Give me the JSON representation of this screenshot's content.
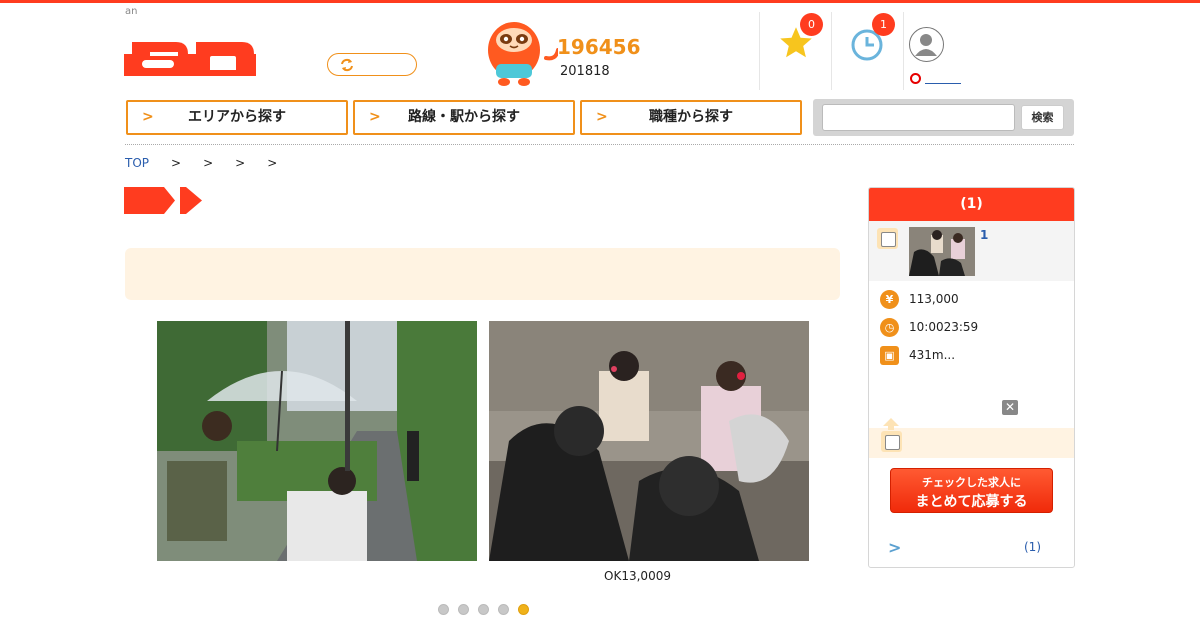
{
  "header": {
    "tagline": "an",
    "counter_main": "196456",
    "counter_sub": "201818",
    "favorites_badge": "0",
    "history_badge": "1"
  },
  "nav": {
    "area": "エリアから探す",
    "route": "路線・駅から探す",
    "job": "職種から探す",
    "search_button": "検索",
    "search_placeholder": ""
  },
  "breadcrumb": {
    "top": "TOP",
    "separators": [
      ">",
      ">",
      ">",
      ">"
    ]
  },
  "gallery": {
    "caption": "OK13,0009",
    "dot_count": 5,
    "active_dot": 5
  },
  "sidebar": {
    "header": "(1)",
    "item_number": "1",
    "salary": "113,000",
    "hours": "10:0023:59",
    "station": "431m...",
    "apply_line1": "チェックした求人に",
    "apply_line2": "まとめて応募する",
    "link_text": "(1)"
  },
  "icons": {
    "salary": "yen-icon",
    "hours": "clock-icon",
    "station": "train-icon"
  },
  "colors": {
    "brand_red": "#ff3c1f",
    "accent_orange": "#f0901a",
    "link_blue": "#2a5dad"
  }
}
